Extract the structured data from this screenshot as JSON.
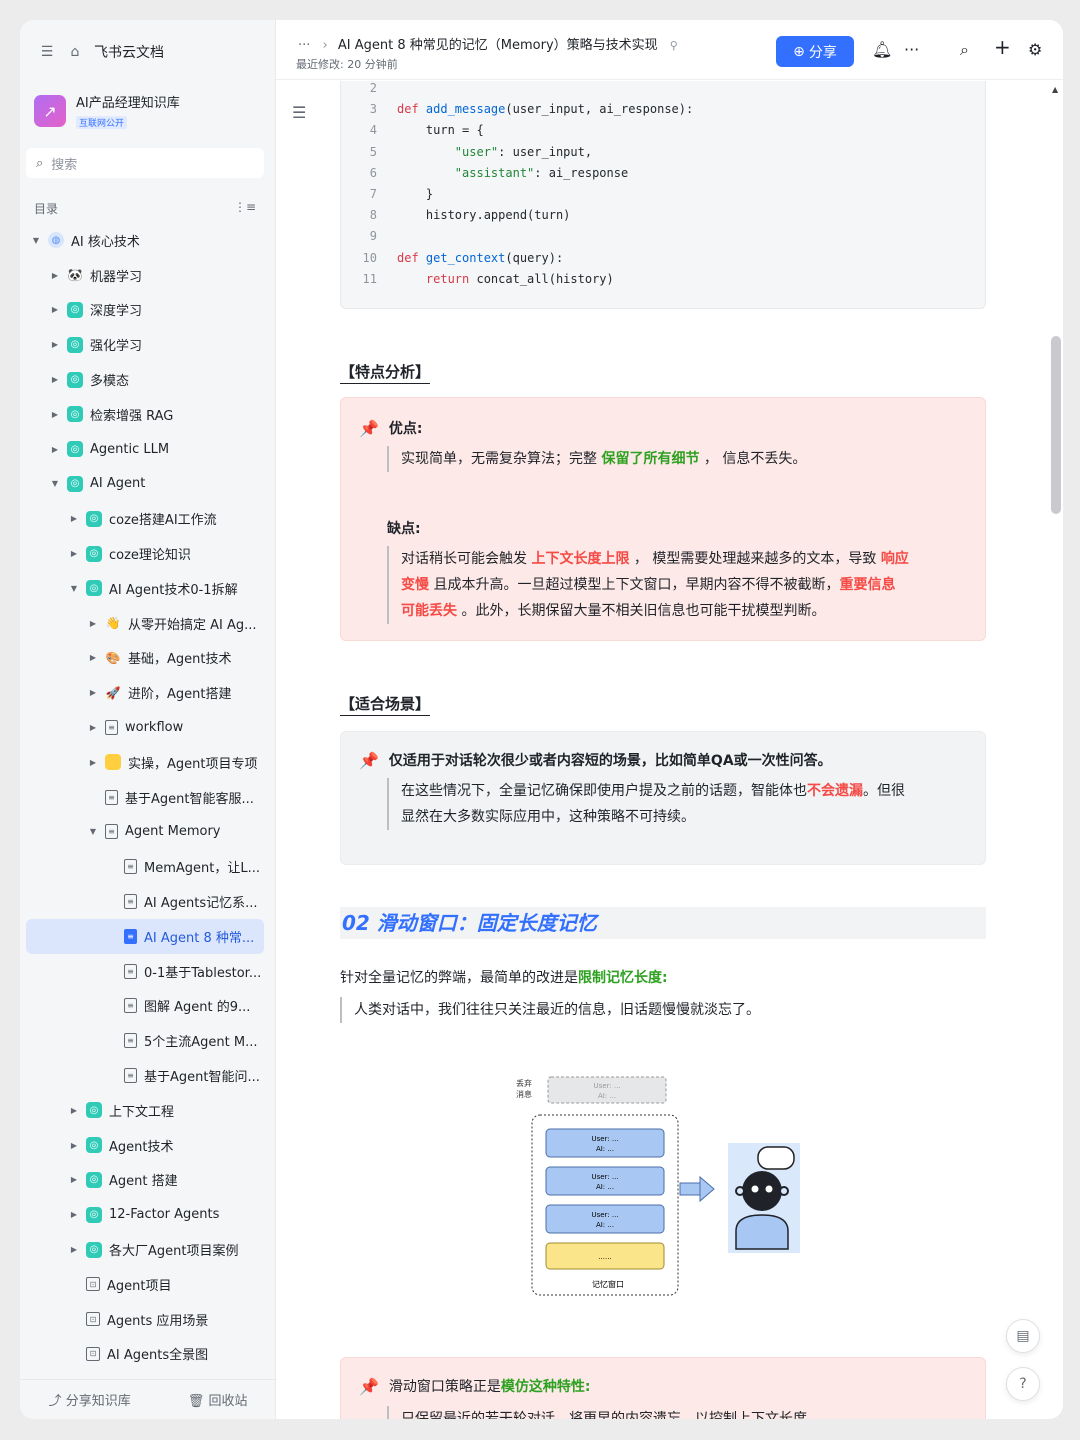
{
  "sidebar": {
    "app_name": "飞书云文档",
    "kb_name": "AI产品经理知识库",
    "kb_badge": "互联网公开",
    "search_placeholder": "搜索",
    "toc_label": "目录",
    "items": [
      {
        "label": "AI 核心技术",
        "indent": 0,
        "arrow": "▼",
        "icon": "globe"
      },
      {
        "label": "机器学习",
        "indent": 1,
        "arrow": "▶",
        "icon": "emoji",
        "glyph": "🐼"
      },
      {
        "label": "深度学习",
        "indent": 1,
        "arrow": "▶",
        "icon": "kb"
      },
      {
        "label": "强化学习",
        "indent": 1,
        "arrow": "▶",
        "icon": "kb"
      },
      {
        "label": "多模态",
        "indent": 1,
        "arrow": "▶",
        "icon": "kb"
      },
      {
        "label": "检索增强 RAG",
        "indent": 1,
        "arrow": "▶",
        "icon": "kb"
      },
      {
        "label": "Agentic LLM",
        "indent": 1,
        "arrow": "▶",
        "icon": "kb"
      },
      {
        "label": "AI Agent",
        "indent": 1,
        "arrow": "▼",
        "icon": "kb"
      },
      {
        "label": "coze搭建AI工作流",
        "indent": 2,
        "arrow": "▶",
        "icon": "kb"
      },
      {
        "label": "coze理论知识",
        "indent": 2,
        "arrow": "▶",
        "icon": "kb"
      },
      {
        "label": "AI Agent技术0-1拆解",
        "indent": 2,
        "arrow": "▼",
        "icon": "kb"
      },
      {
        "label": "从零开始搞定 AI Ag...",
        "indent": 3,
        "arrow": "▶",
        "icon": "emoji",
        "glyph": "👋"
      },
      {
        "label": "基础，Agent技术",
        "indent": 3,
        "arrow": "▶",
        "icon": "emoji",
        "glyph": "🎨"
      },
      {
        "label": "进阶，Agent搭建",
        "indent": 3,
        "arrow": "▶",
        "icon": "emoji",
        "glyph": "🚀"
      },
      {
        "label": "workflow",
        "indent": 3,
        "arrow": "▶",
        "icon": "doc"
      },
      {
        "label": "实操，Agent项目专项",
        "indent": 3,
        "arrow": "▶",
        "icon": "folder"
      },
      {
        "label": "基于Agent智能客服...",
        "indent": 3,
        "arrow": "",
        "icon": "doc"
      },
      {
        "label": "Agent Memory",
        "indent": 3,
        "arrow": "▼",
        "icon": "doc"
      },
      {
        "label": "MemAgent，让L...",
        "indent": 4,
        "arrow": "",
        "icon": "doc"
      },
      {
        "label": "AI Agents记忆系...",
        "indent": 4,
        "arrow": "",
        "icon": "doc"
      },
      {
        "label": "AI Agent 8 种常...",
        "indent": 4,
        "arrow": "",
        "icon": "doc-blue",
        "active": true
      },
      {
        "label": "0-1基于Tablestor...",
        "indent": 4,
        "arrow": "",
        "icon": "doc"
      },
      {
        "label": "图解 Agent 的9...",
        "indent": 4,
        "arrow": "",
        "icon": "doc"
      },
      {
        "label": "5个主流Agent M...",
        "indent": 4,
        "arrow": "",
        "icon": "doc"
      },
      {
        "label": "基于Agent智能问...",
        "indent": 4,
        "arrow": "",
        "icon": "doc"
      },
      {
        "label": "上下文工程",
        "indent": 2,
        "arrow": "▶",
        "icon": "kb"
      },
      {
        "label": "Agent技术",
        "indent": 2,
        "arrow": "▶",
        "icon": "kb"
      },
      {
        "label": "Agent 搭建",
        "indent": 2,
        "arrow": "▶",
        "icon": "kb"
      },
      {
        "label": "12-Factor Agents",
        "indent": 2,
        "arrow": "▶",
        "icon": "kb"
      },
      {
        "label": "各大厂Agent项目案例",
        "indent": 2,
        "arrow": "▶",
        "icon": "kb"
      },
      {
        "label": "Agent项目",
        "indent": 2,
        "arrow": "",
        "icon": "sheet"
      },
      {
        "label": "Agents 应用场景",
        "indent": 2,
        "arrow": "",
        "icon": "sheet"
      },
      {
        "label": "AI Agents全景图",
        "indent": 2,
        "arrow": "",
        "icon": "sheet"
      }
    ],
    "bottom_share": "分享知识库",
    "bottom_trash": "回收站"
  },
  "header": {
    "title": "AI Agent 8 种常见的记忆（Memory）策略与技术实现",
    "last_modified": "最近修改: 20 分钟前",
    "share_label": "分享"
  },
  "code": {
    "lines": [
      {
        "n": "2",
        "parts": []
      },
      {
        "n": "3",
        "parts": [
          [
            "kw",
            "def "
          ],
          [
            "fn",
            "add_message"
          ],
          [
            "plain",
            "(user_input, ai_response):"
          ]
        ]
      },
      {
        "n": "4",
        "parts": [
          [
            "plain",
            "    turn = {"
          ]
        ]
      },
      {
        "n": "5",
        "parts": [
          [
            "plain",
            "        "
          ],
          [
            "str",
            "\"user\""
          ],
          [
            "plain",
            ": user_input,"
          ]
        ]
      },
      {
        "n": "6",
        "parts": [
          [
            "plain",
            "        "
          ],
          [
            "str",
            "\"assistant\""
          ],
          [
            "plain",
            ": ai_response"
          ]
        ]
      },
      {
        "n": "7",
        "parts": [
          [
            "plain",
            "    }"
          ]
        ]
      },
      {
        "n": "8",
        "parts": [
          [
            "plain",
            "    history.append(turn)"
          ]
        ]
      },
      {
        "n": "9",
        "parts": []
      },
      {
        "n": "10",
        "parts": [
          [
            "kw",
            "def "
          ],
          [
            "fn",
            "get_context"
          ],
          [
            "plain",
            "(query):"
          ]
        ]
      },
      {
        "n": "11",
        "parts": [
          [
            "plain",
            "    "
          ],
          [
            "kw",
            "return "
          ],
          [
            "plain",
            "concat_all(history)"
          ]
        ]
      }
    ]
  },
  "analysis": {
    "title": "【特点分析】",
    "pros_label": "优点:",
    "pros_a": "实现简单，无需复杂算法；完整 ",
    "pros_b": "保留了所有细节",
    "pros_c": " ， 信息不丢失。",
    "cons_label": "缺点:",
    "cons_1a": "对话稍长可能会触发 ",
    "cons_1b": "上下文长度上限",
    "cons_1c": " ， 模型需要处理越来越多的文本，导致 ",
    "cons_1d": "响应",
    "cons_2a": "变慢",
    "cons_2b": " 且成本升高。一旦超过模型上下文窗口，早期内容不得不被截断，",
    "cons_2c": "重要信息",
    "cons_3a": "可能丢失",
    "cons_3b": " 。此外，长期保留大量不相关旧信息也可能干扰模型判断。"
  },
  "scenario": {
    "title": "【适合场景】",
    "headline": "仅适用于对话轮次很少或者内容短的场景，比如简单QA或一次性问答。",
    "line1a": "在这些情况下，全量记忆确保即使用户提及之前的话题，智能体也",
    "line1b": "不会遗漏",
    "line1c": "。但很",
    "line2": "显然在大多数实际应用中，这种策略不可持续。"
  },
  "section2": {
    "heading": "02 滑动窗口：固定长度记忆",
    "intro_a": "针对全量记忆的弊端，最简单的改进是",
    "intro_b": "限制记忆长度:",
    "quote": "人类对话中，我们往往只关注最近的信息，旧话题慢慢就淡忘了。"
  },
  "diagram": {
    "discard_label_1": "丢弃",
    "discard_label_2": "消息",
    "msg_user": "User: ...",
    "msg_ai": "AI: ...",
    "ellipsis": "......",
    "window_label": "记忆窗口"
  },
  "callout3": {
    "a": "滑动窗口策略正是",
    "b": "模仿这种特性:",
    "quote": "只保留最近的若干轮对话，将更早的内容遗忘，以控制上下文长度。"
  },
  "colors": {
    "accent": "#3370ff",
    "green": "#2ea121",
    "red": "#f54a45"
  }
}
